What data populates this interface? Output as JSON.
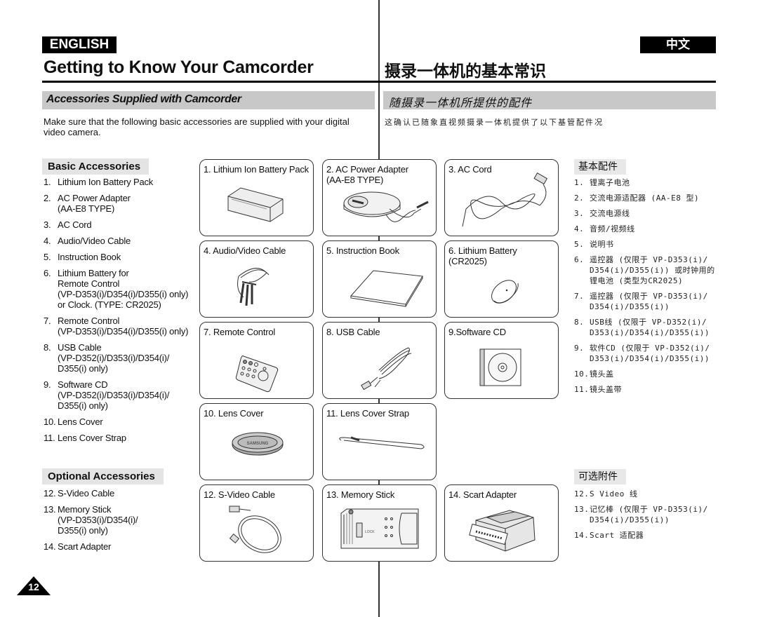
{
  "header": {
    "lang_en": "ENGLISH",
    "lang_zh": "中文",
    "title_en": "Getting to Know Your Camcorder",
    "title_zh": "摄录一体机的基本常识"
  },
  "section": {
    "title_en": "Accessories Supplied with Camcorder",
    "title_zh": "随摄录一体机所提供的配件",
    "intro_en": "Make sure that the following basic accessories are supplied with your digital video camera.",
    "intro_zh": "这确认已随象直视频摄录一体机提供了以下基管配件况"
  },
  "basic_en": {
    "heading": "Basic Accessories",
    "items": [
      {
        "num": "1.",
        "text": "Lithium Ion Battery Pack"
      },
      {
        "num": "2.",
        "text": "AC Power Adapter\n(AA-E8 TYPE)"
      },
      {
        "num": "3.",
        "text": "AC Cord"
      },
      {
        "num": "4.",
        "text": "Audio/Video Cable"
      },
      {
        "num": "5.",
        "text": "Instruction Book"
      },
      {
        "num": "6.",
        "text": "Lithium Battery for\nRemote Control\n(VP-D353(i)/D354(i)/D355(i) only)\nor Clock. (TYPE: CR2025)"
      },
      {
        "num": "7.",
        "text": "Remote Control\n(VP-D353(i)/D354(i)/D355(i) only)"
      },
      {
        "num": "8.",
        "text": "USB Cable\n(VP-D352(i)/D353(i)/D354(i)/\nD355(i) only)"
      },
      {
        "num": "9.",
        "text": "Software CD\n(VP-D352(i)/D353(i)/D354(i)/\nD355(i) only)"
      },
      {
        "num": "10.",
        "text": "Lens Cover"
      },
      {
        "num": "11.",
        "text": "Lens Cover Strap"
      }
    ]
  },
  "optional_en": {
    "heading": "Optional Accessories",
    "items": [
      {
        "num": "12.",
        "text": "S-Video Cable"
      },
      {
        "num": "13.",
        "text": "Memory Stick\n(VP-D353(i)/D354(i)/\nD355(i) only)"
      },
      {
        "num": "14.",
        "text": "Scart Adapter"
      }
    ]
  },
  "basic_zh": {
    "heading": "基本配件",
    "items": [
      {
        "num": "1.",
        "text": "锂离子电池"
      },
      {
        "num": "2.",
        "text": "交流电源适配器 (AA-E8 型)"
      },
      {
        "num": "3.",
        "text": "交流电源线"
      },
      {
        "num": "4.",
        "text": "音频/视频线"
      },
      {
        "num": "5.",
        "text": "说明书"
      },
      {
        "num": "6.",
        "text": "遥控器 (仅限于 VP-D353(i)/\nD354(i)/D355(i)) 或时钟用的\n锂电池 (类型为CR2025)"
      },
      {
        "num": "7.",
        "text": "遥控器 (仅限于 VP-D353(i)/\nD354(i)/D355(i))"
      },
      {
        "num": "8.",
        "text": "USB线 (仅限于 VP-D352(i)/\nD353(i)/D354(i)/D355(i))"
      },
      {
        "num": "9.",
        "text": "软件CD (仅限于 VP-D352(i)/\nD353(i)/D354(i)/D355(i))"
      },
      {
        "num": "10.",
        "text": "镜头盖"
      },
      {
        "num": "11.",
        "text": "镜头盖带"
      }
    ]
  },
  "optional_zh": {
    "heading": "可选附件",
    "items": [
      {
        "num": "12.",
        "text": "S Video 线"
      },
      {
        "num": "13.",
        "text": "记忆棒 (仅限于 VP-D353(i)/\nD354(i)/D355(i))"
      },
      {
        "num": "14.",
        "text": "Scart 适配器"
      }
    ]
  },
  "boxes": [
    {
      "label": "1. Lithium Ion Battery Pack",
      "icon": "battery-pack-icon"
    },
    {
      "label": "2. AC Power Adapter\n    (AA-E8 TYPE)",
      "icon": "ac-adapter-icon"
    },
    {
      "label": "3. AC Cord",
      "icon": "ac-cord-icon"
    },
    {
      "label": "4. Audio/Video Cable",
      "icon": "av-cable-icon"
    },
    {
      "label": "5. Instruction Book",
      "icon": "instruction-book-icon"
    },
    {
      "label": "6. Lithium Battery\n    (CR2025)",
      "icon": "coin-battery-icon"
    },
    {
      "label": "7. Remote Control",
      "icon": "remote-control-icon"
    },
    {
      "label": "8. USB Cable",
      "icon": "usb-cable-icon"
    },
    {
      "label": "9.Software CD",
      "icon": "software-cd-icon"
    },
    {
      "label": "10. Lens Cover",
      "icon": "lens-cover-icon"
    },
    {
      "label": "11. Lens Cover Strap",
      "icon": "lens-strap-icon"
    },
    {
      "label": "12. S-Video Cable",
      "icon": "s-video-cable-icon"
    },
    {
      "label": "13. Memory Stick",
      "icon": "memory-stick-icon"
    },
    {
      "label": "14. Scart Adapter",
      "icon": "scart-adapter-icon"
    }
  ],
  "lens_cover_brand": "SAMSUNG",
  "memory_stick_lock": "LOCK",
  "page_number": "12"
}
